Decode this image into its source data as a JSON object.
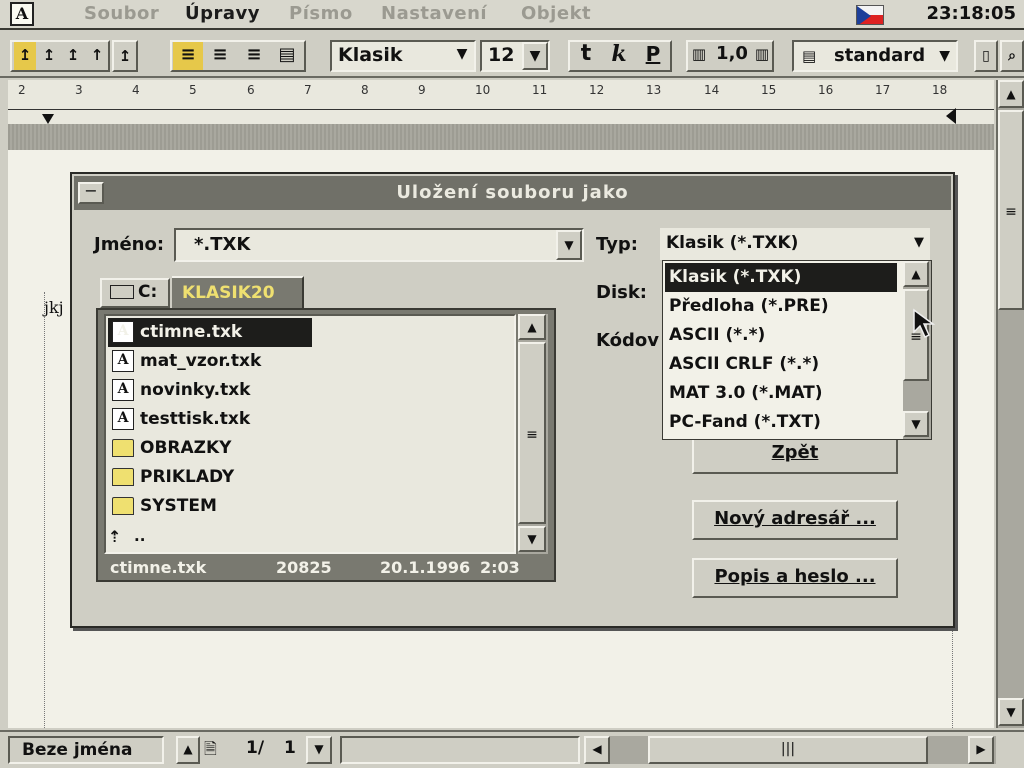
{
  "menubar": {
    "items": [
      "Soubor",
      "Úpravy",
      "Písmo",
      "Nastavení",
      "Objekt"
    ],
    "active_index": 1,
    "clock": "23:18:05"
  },
  "toolbar": {
    "font_name": "Klasik",
    "font_size": "12",
    "bold_label": "t",
    "italic_label": "k",
    "underline_label": "P",
    "line_spacing": "1,0",
    "style_name": "standard"
  },
  "ruler": {
    "numbers": [
      "2",
      "3",
      "4",
      "5",
      "6",
      "7",
      "8",
      "9",
      "10",
      "11",
      "12",
      "13",
      "14",
      "15",
      "16",
      "17",
      "18"
    ]
  },
  "document": {
    "visible_text": "jkj"
  },
  "dialog": {
    "title": "Uložení souboru jako",
    "name_label": "Jméno:",
    "name_value": "*.TXK",
    "type_label": "Typ:",
    "type_value": "Klasik (*.TXK)",
    "disk_label": "Disk:",
    "code_label": "Kódov",
    "tabs": {
      "drive": "C:",
      "folder": "KLASIK20"
    },
    "files": [
      {
        "name": "ctimne.txk",
        "kind": "doc",
        "selected": true
      },
      {
        "name": "mat_vzor.txk",
        "kind": "doc",
        "selected": false
      },
      {
        "name": "novinky.txk",
        "kind": "doc",
        "selected": false
      },
      {
        "name": "testtisk.txk",
        "kind": "doc",
        "selected": false
      },
      {
        "name": "OBRAZKY",
        "kind": "folder",
        "selected": false
      },
      {
        "name": "PRIKLADY",
        "kind": "folder",
        "selected": false
      },
      {
        "name": "SYSTEM",
        "kind": "folder",
        "selected": false
      }
    ],
    "up_dir": "..",
    "file_info": {
      "name": "ctimne.txk",
      "size": "20825",
      "date": "20.1.1996",
      "time": "2:03"
    },
    "type_options": [
      "Klasik (*.TXK)",
      "Předloha (*.PRE)",
      "ASCII (*.*)",
      "ASCII CRLF (*.*)",
      "MAT 3.0 (*.MAT)",
      "PC-Fand (*.TXT)"
    ],
    "type_selected_index": 0,
    "buttons": {
      "back": "Zpět",
      "new_dir": "Nový adresář ...",
      "desc_pass": "Popis a heslo ..."
    }
  },
  "statusbar": {
    "doc_name": "Beze jména",
    "page_label": "1/",
    "page_number": "1"
  },
  "colors": {
    "face": "#cfcec4",
    "title": "#707068",
    "selection": "#1d1d1b",
    "folder": "#efe070"
  }
}
